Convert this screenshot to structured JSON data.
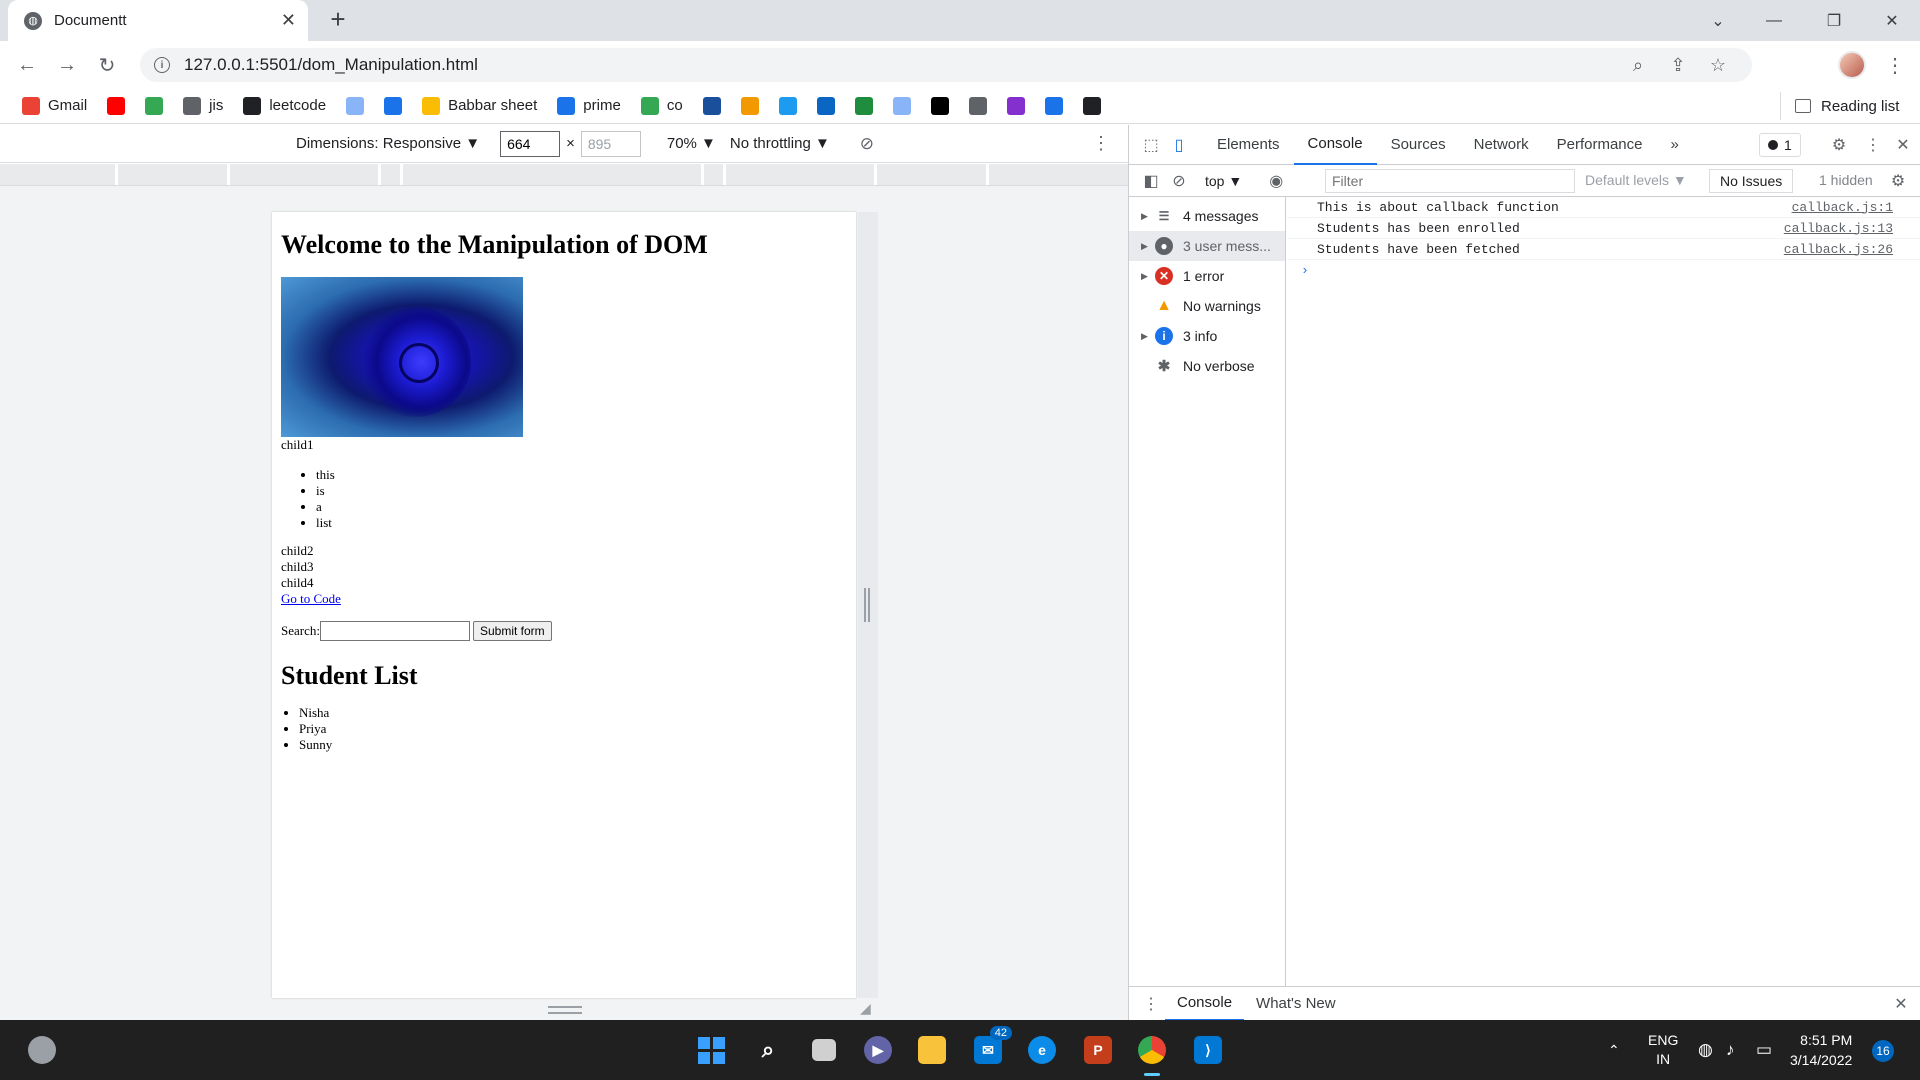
{
  "browser": {
    "tab_title": "Documentt",
    "url": "127.0.0.1:5501/dom_Manipulation.html",
    "bookmarks": [
      {
        "label": "Gmail",
        "icon": "gmail-icon",
        "color": "#ea4335"
      },
      {
        "label": "",
        "icon": "youtube-icon",
        "color": "#ff0000"
      },
      {
        "label": "",
        "icon": "maps-icon",
        "color": "#34a853"
      },
      {
        "label": "jis",
        "icon": "globe-icon",
        "color": "#5f6368"
      },
      {
        "label": "leetcode",
        "icon": "leetcode-icon",
        "color": "#202124"
      },
      {
        "label": "",
        "icon": "w3r-icon",
        "color": "#8ab4f8"
      },
      {
        "label": "",
        "icon": "chart-bookmark-icon",
        "color": "#1a73e8"
      },
      {
        "label": "Babbar sheet",
        "icon": "drive-icon",
        "color": "#fbbc04"
      },
      {
        "label": "prime",
        "icon": "prime-video-icon",
        "color": "#1a73e8"
      },
      {
        "label": "co",
        "icon": "drive-icon",
        "color": "#34a853"
      },
      {
        "label": "",
        "icon": "search-bookmark-icon",
        "color": "#1a4f9c"
      },
      {
        "label": "",
        "icon": "bookmark-orange-icon",
        "color": "#f29900"
      },
      {
        "label": "",
        "icon": "twitter-icon",
        "color": "#1d9bf0"
      },
      {
        "label": "",
        "icon": "linkedin-icon",
        "color": "#0a66c2"
      },
      {
        "label": "",
        "icon": "green-bookmark-icon",
        "color": "#1e8e3e"
      },
      {
        "label": "",
        "icon": "leaf-icon",
        "color": "#8ab4f8"
      },
      {
        "label": "",
        "icon": "hn-icon",
        "color": "#000000"
      },
      {
        "label": "",
        "icon": "bookmark-flame-icon",
        "color": "#5f6368"
      },
      {
        "label": "",
        "icon": "bookmark-purple-icon",
        "color": "#8430ce"
      },
      {
        "label": "",
        "icon": "bookmark-blue-icon",
        "color": "#1a73e8"
      },
      {
        "label": "",
        "icon": "github-icon",
        "color": "#202124"
      }
    ],
    "reading_list": "Reading list"
  },
  "device_toolbar": {
    "dimensions_label": "Dimensions: Responsive",
    "width": "664",
    "height": "895",
    "times": "×",
    "zoom": "70%",
    "throttling": "No throttling"
  },
  "page": {
    "heading": "Welcome to the Manipulation of DOM",
    "child1": "child1",
    "list": [
      "this",
      "is",
      "a",
      "list"
    ],
    "child2": "child2",
    "child3": "child3",
    "child4": "child4",
    "link": "Go to Code",
    "search_label": "Search:",
    "submit": "Submit form",
    "students_heading": "Student List",
    "students": [
      "Nisha",
      "Priya",
      "Sunny"
    ]
  },
  "devtools": {
    "tabs": [
      "Elements",
      "Console",
      "Sources",
      "Network",
      "Performance"
    ],
    "active_tab": "Console",
    "more": "»",
    "issue_count": "1",
    "context": "top",
    "filter_placeholder": "Filter",
    "levels": "Default levels",
    "no_issues": "No Issues",
    "hidden": "1 hidden",
    "sidebar": [
      {
        "label": "4 messages",
        "icon": "list-icon"
      },
      {
        "label": "3 user mess...",
        "icon": "user-icon"
      },
      {
        "label": "1 error",
        "icon": "error-icon"
      },
      {
        "label": "No warnings",
        "icon": "warning-icon"
      },
      {
        "label": "3 info",
        "icon": "info-icon"
      },
      {
        "label": "No verbose",
        "icon": "bug-icon"
      }
    ],
    "messages": [
      {
        "text": "This is about callback function",
        "source": "callback.js:1"
      },
      {
        "text": "Students has been enrolled",
        "source": "callback.js:13"
      },
      {
        "text": "Students have been fetched",
        "source": "callback.js:26"
      }
    ],
    "prompt": "›",
    "drawer_tabs": [
      "Console",
      "What's New"
    ]
  },
  "taskbar": {
    "mail_badge": "42",
    "lang_line1": "ENG",
    "lang_line2": "IN",
    "time": "8:51 PM",
    "date": "3/14/2022",
    "notifications": "16"
  }
}
